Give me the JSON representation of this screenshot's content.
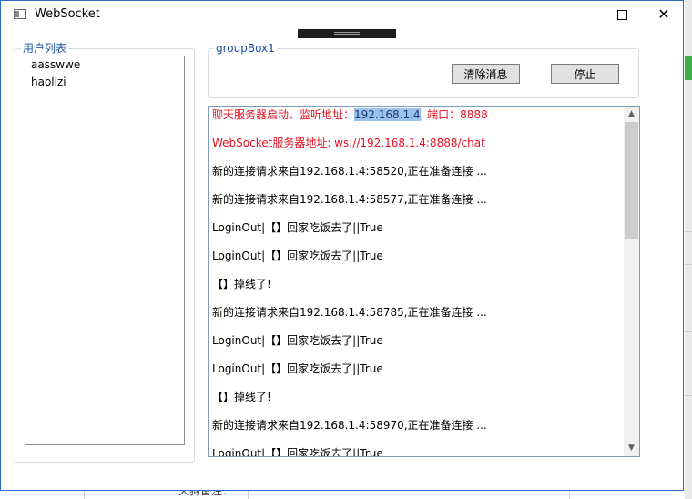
{
  "window": {
    "title": "WebSocket"
  },
  "background_form": {
    "label_fragment": "天狗备注："
  },
  "users_group": {
    "legend": "用户列表",
    "items": [
      "aasswwe",
      "haolizi"
    ]
  },
  "control_group": {
    "legend": "groupBox1",
    "clear_label": "清除消息",
    "stop_label": "停止"
  },
  "log": {
    "line1": {
      "prefix": "聊天服务器启动。监听地址：",
      "selected": "192.168.1.4",
      "suffix": ", 端口：8888"
    },
    "line2": "WebSocket服务器地址: ws://192.168.1.4:8888/chat",
    "lines": [
      "新的连接请求来自192.168.1.4:58520,正在准备连接 ...",
      "新的连接请求来自192.168.1.4:58577,正在准备连接 ...",
      "LoginOut|【】回家吃饭去了||True",
      "LoginOut|【】回家吃饭去了||True",
      "【】掉线了!",
      "新的连接请求来自192.168.1.4:58785,正在准备连接 ...",
      "LoginOut|【】回家吃饭去了||True",
      "LoginOut|【】回家吃饭去了||True",
      "【】掉线了!",
      "新的连接请求来自192.168.1.4:58970,正在准备连接 ...",
      "LoginOut|【】回家吃饭去了||True"
    ]
  },
  "colors": {
    "error_text": "#e81123",
    "legend_text": "#1a4fa6",
    "window_border": "#2b6cc4",
    "selection": "#99c2ec",
    "background_accent": "#3fae48"
  }
}
